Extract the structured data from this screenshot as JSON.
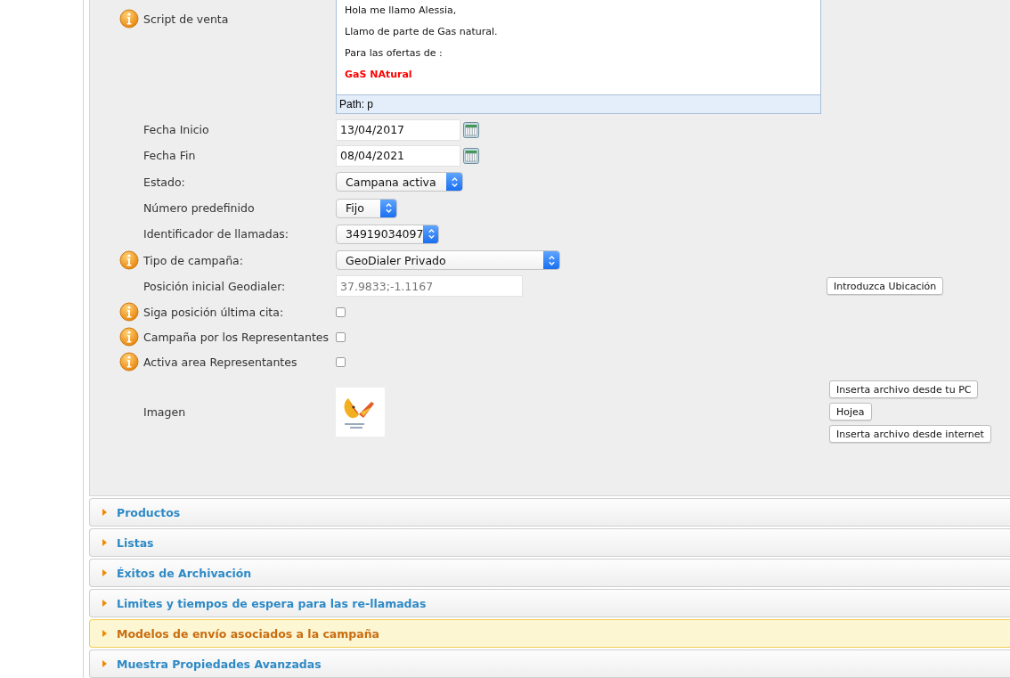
{
  "script": {
    "label": "Script de venta",
    "info": true,
    "lines": [
      {
        "text": "Hola me llamo Alessia,",
        "kind": "plain"
      },
      {
        "text": "Llamo de parte de Gas natural.",
        "kind": "plain"
      },
      {
        "text": "Para las ofertas de :",
        "kind": "plain"
      },
      {
        "text": "GaS NAtural",
        "kind": "highlight"
      }
    ],
    "path": "Path: p"
  },
  "fields": [
    {
      "kind": "date",
      "label": "Fecha Inicio",
      "info": false,
      "value": "13/04/2017"
    },
    {
      "kind": "date",
      "label": "Fecha Fin",
      "info": false,
      "value": "08/04/2021"
    },
    {
      "kind": "select",
      "label": "Estado:",
      "info": false,
      "value": "Campana activa"
    },
    {
      "kind": "select",
      "label": "Número predefinido",
      "info": false,
      "value": "Fijo"
    },
    {
      "kind": "select",
      "label": "Identificador de llamadas:",
      "info": false,
      "value": "34919034097"
    },
    {
      "kind": "select",
      "label": "Tipo de campaña:",
      "info": true,
      "value": "GeoDialer Privado"
    },
    {
      "kind": "text",
      "label": "Posición inicial Geodialer:",
      "info": false,
      "value": "37.9833;-1.1167",
      "disabled": true,
      "button": "Introduzca Ubicación"
    },
    {
      "kind": "checkbox",
      "label": "Siga posición última cita:",
      "info": true,
      "checked": false
    },
    {
      "kind": "checkbox",
      "label": "Campaña por los Representantes",
      "info": true,
      "checked": false
    },
    {
      "kind": "checkbox",
      "label": "Activa area Representantes",
      "info": true,
      "checked": false
    }
  ],
  "image": {
    "label": "Imagen",
    "kind": "picture",
    "buttons": [
      "Inserta archivo desde tu PC",
      "Hojea",
      "Inserta archivo desde internet"
    ]
  },
  "sections": [
    {
      "title": "Productos",
      "hovered": false
    },
    {
      "title": "Listas",
      "hovered": false
    },
    {
      "title": "Éxitos de Archivación",
      "hovered": false
    },
    {
      "title": "Limites y tiempos de espera para las re-llamadas",
      "hovered": false
    },
    {
      "title": "Modelos de envío asociados a la campaña",
      "hovered": true
    },
    {
      "title": "Muestra Propiedades Avanzadas",
      "hovered": false
    }
  ]
}
